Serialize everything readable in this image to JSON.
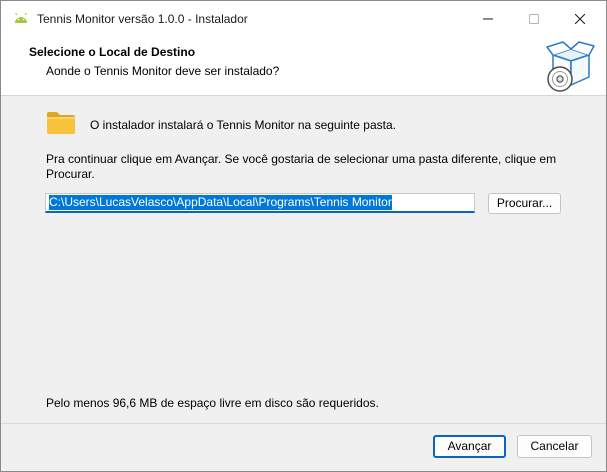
{
  "window": {
    "title": "Tennis Monitor versão 1.0.0 - Instalador",
    "app_icon": "android-icon",
    "controls": [
      "minimize-icon",
      "maximize-icon",
      "close-icon"
    ]
  },
  "header": {
    "title": "Selecione o Local de Destino",
    "subtitle": "Aonde o Tennis Monitor deve ser instalado?",
    "icon": "setup-box-disc-icon"
  },
  "body": {
    "folder_icon": "folder-icon",
    "folder_text": "O instalador instalará o Tennis Monitor na seguinte pasta.",
    "instructions": "Pra continuar clique em Avançar. Se você gostaria de selecionar uma pasta diferente, clique em Procurar.",
    "path_value": "C:\\Users\\LucasVelasco\\AppData\\Local\\Programs\\Tennis Monitor",
    "browse_label": "Procurar...",
    "space_required": "Pelo menos 96,6 MB de espaço livre em disco são requeridos."
  },
  "footer": {
    "next_label": "Avançar",
    "cancel_label": "Cancelar"
  },
  "colors": {
    "accent": "#0078d7",
    "folder": "#f7c33c"
  }
}
